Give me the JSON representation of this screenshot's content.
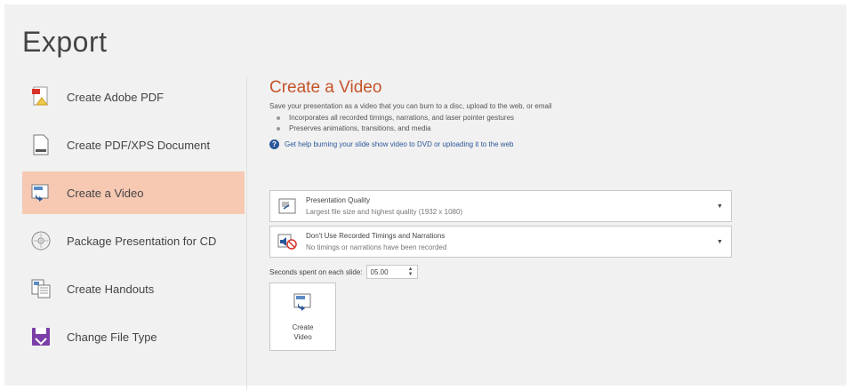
{
  "page": {
    "title": "Export"
  },
  "nav": {
    "items": [
      {
        "label": "Create Adobe PDF",
        "icon": "adobe-pdf-icon"
      },
      {
        "label": "Create PDF/XPS Document",
        "icon": "pdf-xps-document-icon"
      },
      {
        "label": "Create a Video",
        "icon": "video-icon",
        "active": true
      },
      {
        "label": "Package Presentation for CD",
        "icon": "cd-icon"
      },
      {
        "label": "Create Handouts",
        "icon": "handouts-icon"
      },
      {
        "label": "Change File Type",
        "icon": "file-type-icon"
      }
    ]
  },
  "video": {
    "title": "Create a Video",
    "description": "Save your presentation as a video that you can burn to a disc, upload to the web, or email",
    "bullets": [
      "Incorporates all recorded timings, narrations, and laser pointer gestures",
      "Preserves animations, transitions, and media"
    ],
    "help_link": "Get help burning your slide show video to DVD or uploading it to the web",
    "quality": {
      "title": "Presentation Quality",
      "subtitle": "Largest file size and highest quality (1932 x 1080)"
    },
    "timings": {
      "title": "Don't Use Recorded Timings and Narrations",
      "subtitle": "No timings or narrations have been recorded"
    },
    "seconds_label": "Seconds spent on each slide:",
    "seconds_value": "05.00",
    "create_button_label": "Create Video"
  },
  "colors": {
    "accent": "#c5532a",
    "active_nav_bg": "#f7c9b3",
    "link": "#2b579a",
    "panel_bg": "#f1f1f1"
  }
}
